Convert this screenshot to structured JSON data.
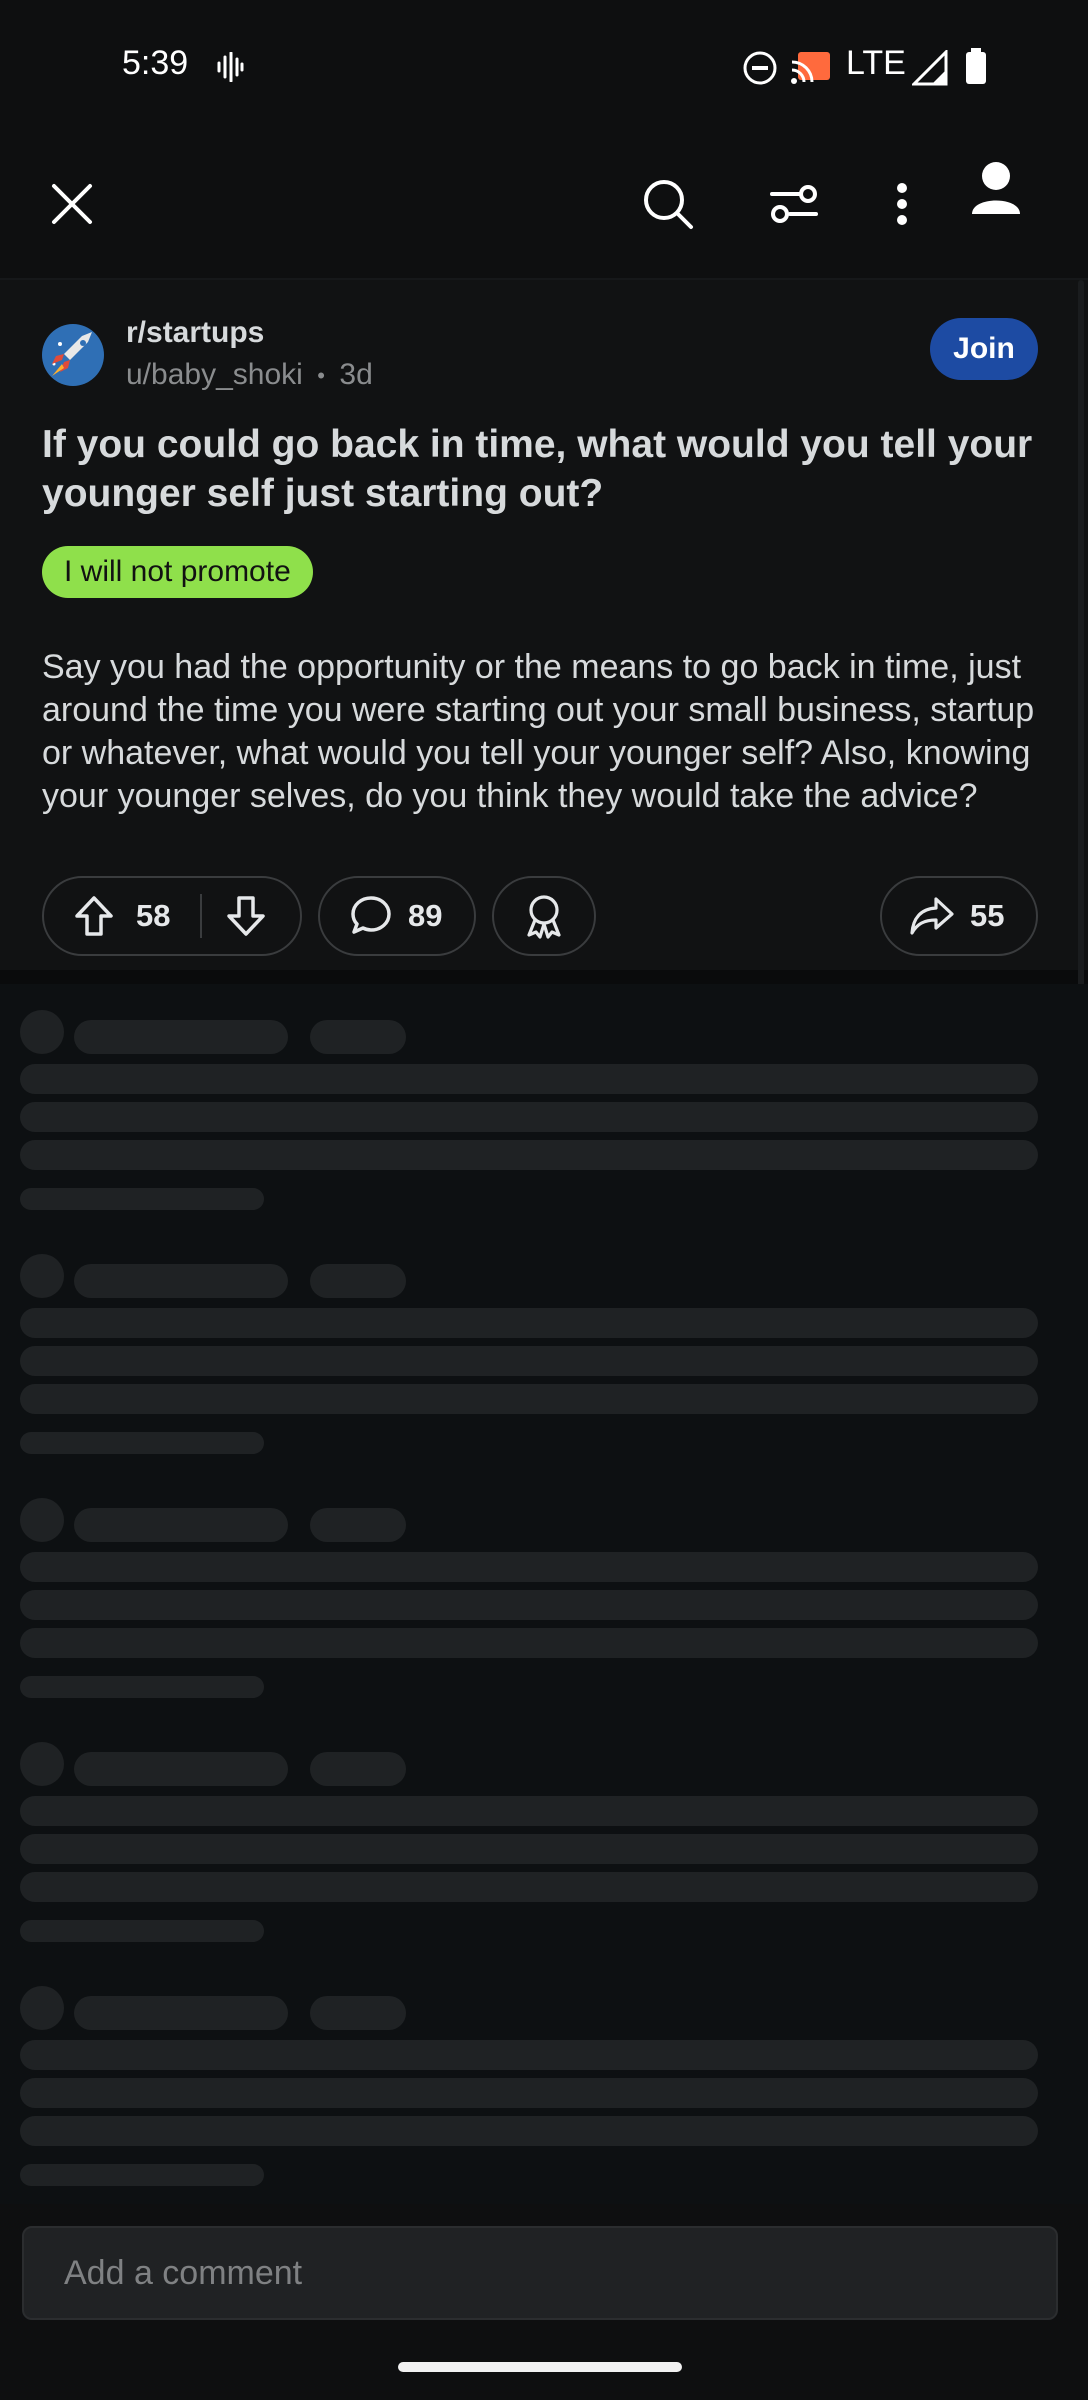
{
  "status_bar": {
    "time": "5:39",
    "network": "LTE"
  },
  "top_bar": {
    "close_icon": "close-icon",
    "search_icon": "search-icon",
    "filter_icon": "sort-filter-icon",
    "more_icon": "more-vertical-icon",
    "profile_icon": "profile-icon"
  },
  "post": {
    "subreddit": "r/startups",
    "author": "u/baby_shoki",
    "age": "3d",
    "join_label": "Join",
    "title": "If you could go back in time, what would you tell your younger self just starting out?",
    "flair": "I will not promote",
    "body": "Say you had the opportunity or the means to go back in time, just around the time you were starting out your small business, startup or whatever, what would you tell your younger self? Also, knowing your younger selves, do you think they would take the advice?",
    "upvotes": "58",
    "comments": "89",
    "shares": "55"
  },
  "comment_input": {
    "placeholder": "Add a comment"
  },
  "colors": {
    "background": "#0e0f10",
    "join_button": "#1d4ba3",
    "flair": "#8fe04b"
  }
}
